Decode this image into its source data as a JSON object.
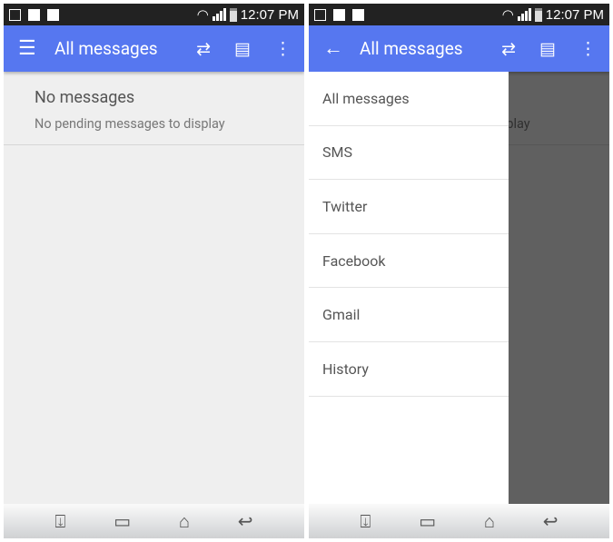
{
  "status": {
    "time": "12:07 PM"
  },
  "appbar": {
    "title": "All messages"
  },
  "empty": {
    "title": "No messages",
    "subtitle": "No pending messages to display"
  },
  "drawer": {
    "items": [
      "All messages",
      "SMS",
      "Twitter",
      "Facebook",
      "Gmail",
      "History"
    ]
  },
  "colors": {
    "appbar": "#5677f0"
  }
}
